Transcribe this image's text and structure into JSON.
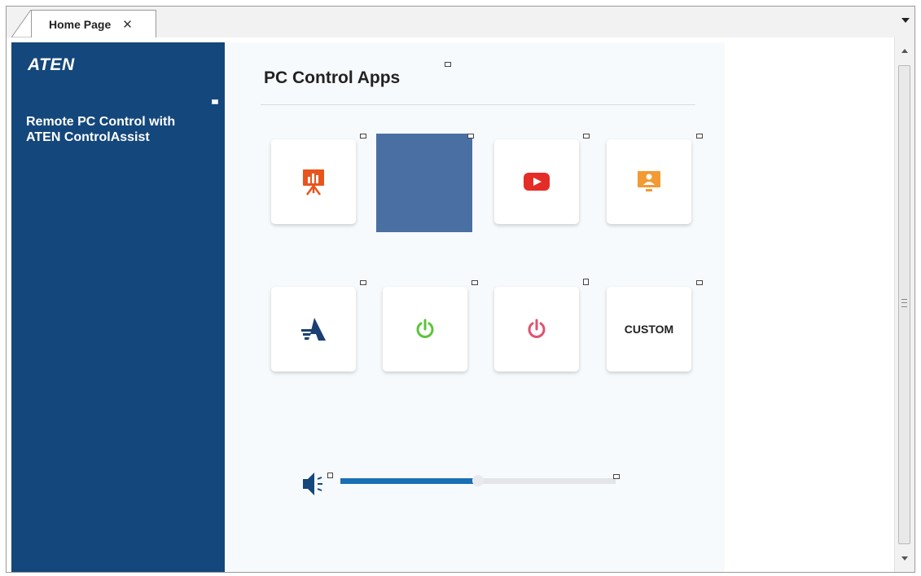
{
  "tab": {
    "label": "Home Page",
    "close_glyph": "✕"
  },
  "sidebar": {
    "logo": "ATEN",
    "subtitle_line1": "Remote PC Control with",
    "subtitle_line2": "ATEN ControlAssist"
  },
  "main": {
    "title": "PC Control Apps",
    "apps": [
      {
        "icon": "presentation-icon",
        "label": ""
      },
      {
        "icon": "",
        "label": "",
        "selected": true
      },
      {
        "icon": "youtube-icon",
        "label": ""
      },
      {
        "icon": "monitor-user-icon",
        "label": ""
      },
      {
        "icon": "aten-logo-icon",
        "label": ""
      },
      {
        "icon": "power-on-icon",
        "label": ""
      },
      {
        "icon": "power-off-icon",
        "label": ""
      },
      {
        "icon": "",
        "label": "CUSTOM"
      }
    ],
    "volume": {
      "level": 0.5,
      "icon": "speaker-icon"
    }
  },
  "colors": {
    "sidebar": "#14477b",
    "selected_tile": "#4a6fa3",
    "volume_fill": "#1a6fb3",
    "presentation": "#e8541c",
    "youtube": "#e52d27",
    "monitor": "#f29a33",
    "power_on": "#5cc43b",
    "power_off": "#e0526e"
  }
}
